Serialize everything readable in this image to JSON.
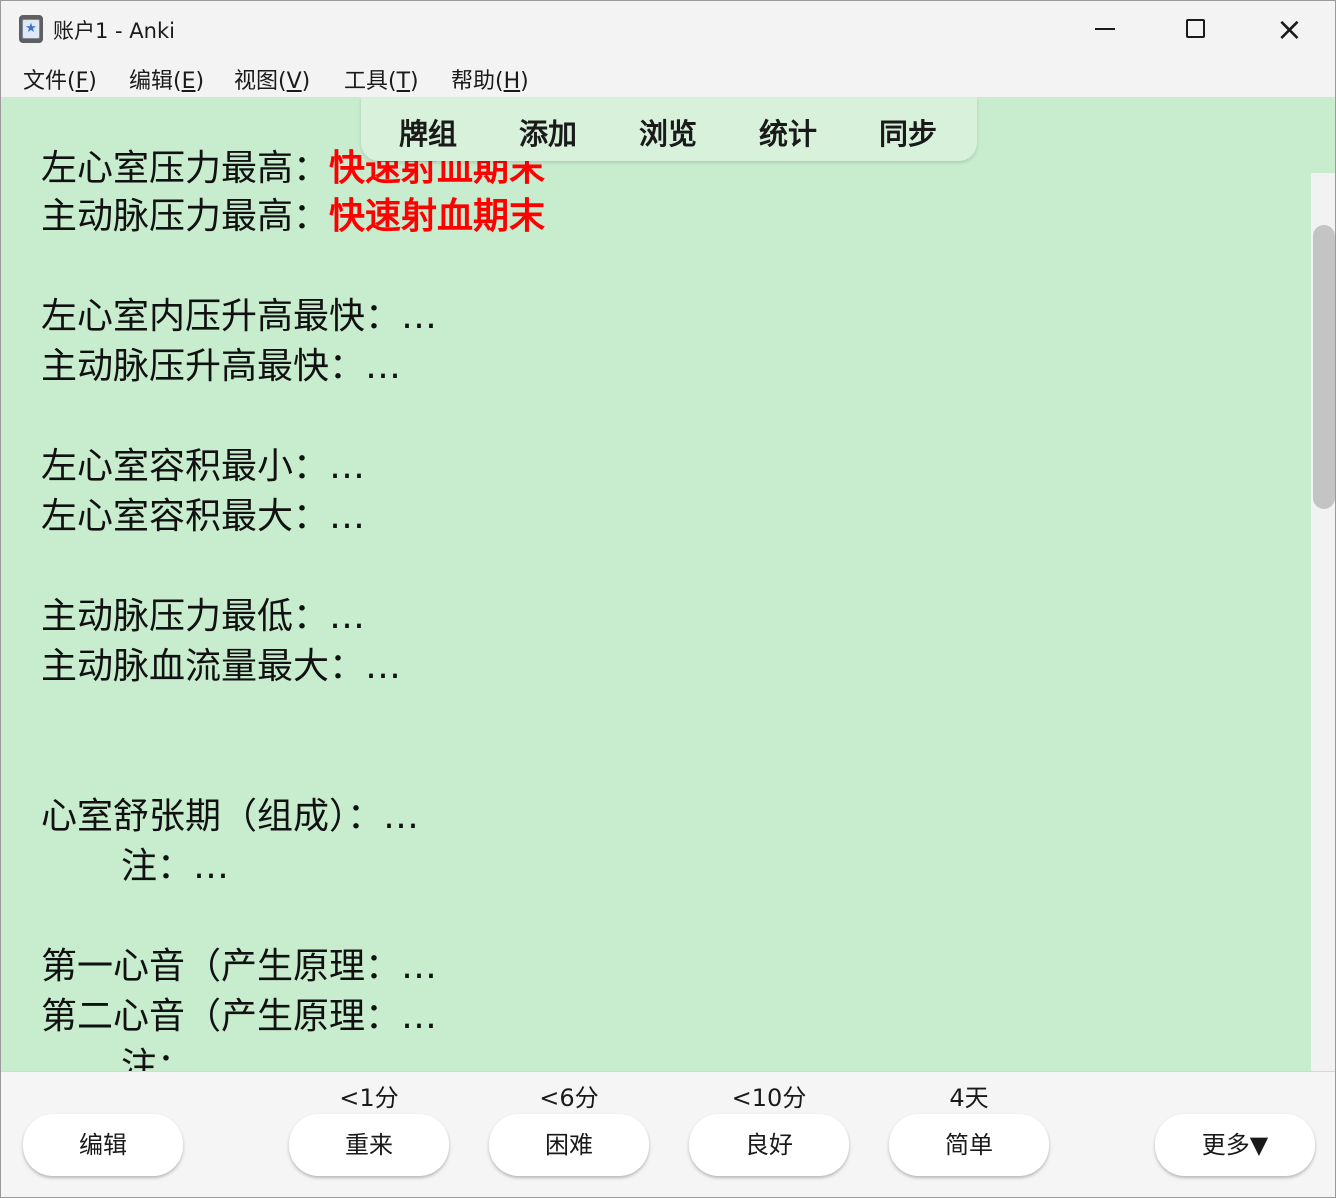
{
  "window": {
    "title": "账户1 - Anki"
  },
  "menu": [
    {
      "label": "文件(",
      "key": "F",
      "end": ")"
    },
    {
      "label": "编辑(",
      "key": "E",
      "end": ")"
    },
    {
      "label": "视图(",
      "key": "V",
      "end": ")"
    },
    {
      "label": "工具(",
      "key": "T",
      "end": ")"
    },
    {
      "label": "帮助(",
      "key": "H",
      "end": ")"
    }
  ],
  "toolbar": [
    "牌组",
    "添加",
    "浏览",
    "统计",
    "同步"
  ],
  "card": {
    "partial_line": {
      "label": "左心室压力最高：",
      "answer": "快速射血期末"
    },
    "lines": [
      {
        "label": "主动脉压力最高：",
        "answer": "快速射血期末"
      },
      {
        "label": "左心室内压升高最快：…"
      },
      {
        "label": "主动脉压升高最快：…"
      },
      {
        "label": "左心室容积最小：…"
      },
      {
        "label": "左心室容积最大：…"
      },
      {
        "label": "主动脉压力最低：…"
      },
      {
        "label": "主动脉血流量最大：…"
      },
      {
        "label": "心室舒张期（组成）：…"
      },
      {
        "label": "注：…"
      },
      {
        "label": "第一心音（产生原理：…"
      },
      {
        "label": "第二心音（产生原理：…"
      },
      {
        "label": "注："
      }
    ]
  },
  "answer_bar": {
    "edit_label": "编辑",
    "more_label": "更多▼",
    "buttons": [
      {
        "interval": "<1分",
        "label": "重来"
      },
      {
        "interval": "<6分",
        "label": "困难"
      },
      {
        "interval": "<10分",
        "label": "良好"
      },
      {
        "interval": "4天",
        "label": "简单"
      }
    ]
  },
  "colors": {
    "card_bg": "#c8ecce",
    "answer_highlight": "#ff0000"
  }
}
